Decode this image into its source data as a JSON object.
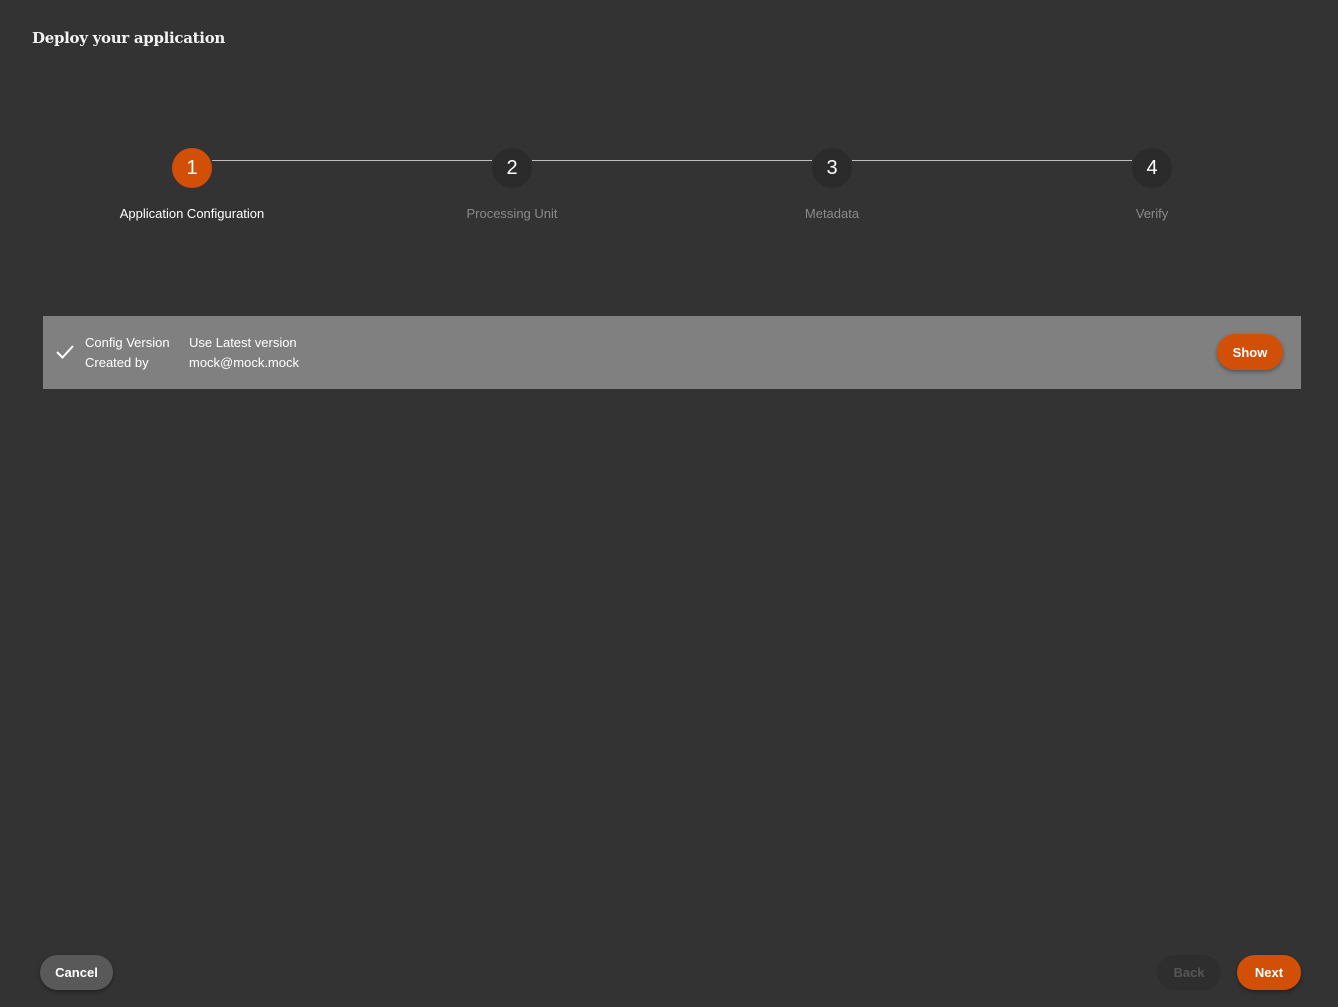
{
  "title": "Deploy your application",
  "colors": {
    "background": "#333333",
    "accent": "#d14f07",
    "panel": "#808080"
  },
  "stepper": {
    "active_index": 0,
    "steps": [
      {
        "number": "1",
        "label": "Application Configuration"
      },
      {
        "number": "2",
        "label": "Processing Unit"
      },
      {
        "number": "3",
        "label": "Metadata"
      },
      {
        "number": "4",
        "label": "Verify"
      }
    ]
  },
  "config": {
    "status_icon": "check-icon",
    "rows": [
      {
        "key": "Config Version",
        "value": "Use Latest version"
      },
      {
        "key": "Created by",
        "value": "mock@mock.mock"
      }
    ],
    "show_label": "Show"
  },
  "footer": {
    "cancel_label": "Cancel",
    "back_label": "Back",
    "next_label": "Next"
  }
}
